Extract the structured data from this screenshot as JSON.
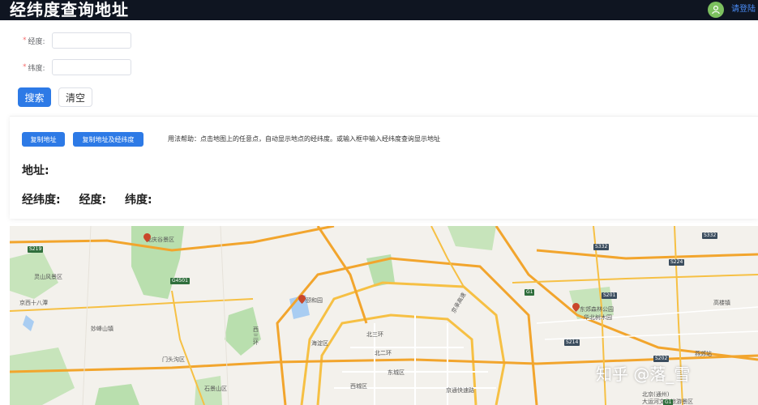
{
  "header": {
    "title": "经纬度查询地址",
    "login_link": "请登陆",
    "avatar_icon": "user-icon"
  },
  "form": {
    "longitude": {
      "required_mark": "*",
      "label": "经度:",
      "value": ""
    },
    "latitude": {
      "required_mark": "*",
      "label": "纬度:",
      "value": ""
    },
    "search_button": "搜索",
    "clear_button": "清空"
  },
  "result": {
    "copy_address_button": "复制地址",
    "copy_address_coords_button": "复制地址及经纬度",
    "help_text": "用法帮助：点击地图上的任意点，自动显示地点的经纬度。或输入框中输入经纬度查询显示地址",
    "address_label": "地址:",
    "coords_label": "经纬度:",
    "lng_label": "经度:",
    "lat_label": "纬度:"
  },
  "map": {
    "labels": {
      "longqing": "龙庆谷景区",
      "yiheyuan": "颐和园",
      "mentougou": "门头沟区",
      "xisanhuan": "西三环",
      "beisanhuan": "北三环",
      "beierhuan": "北二环",
      "haidian": "海淀区",
      "dongcheng": "东城区",
      "xicheng": "西城区",
      "shijingshan": "石景山区",
      "jingtong": "京通快速路",
      "dongjiao": "东郊森林公园",
      "huabei": "华北树木园",
      "gaolou": "高楼镇",
      "yanjiao": "燕郊站",
      "beijing_tz": "北京(通州)",
      "yunhe": "大运河文化旅游景区",
      "zhenggu": "京西十八潭",
      "miaofeng": "妙峰山镇",
      "lingshan": "灵山风景区",
      "jingcheng": "京承高速"
    },
    "shields": [
      "S219",
      "G4501",
      "S332",
      "S224",
      "S332",
      "S201",
      "G1",
      "S214",
      "S202",
      "G1"
    ]
  },
  "watermark": "知乎 @落_雪",
  "colors": {
    "header_bg": "#0f1521",
    "primary": "#2d7ae6",
    "link": "#4a8cf7",
    "avatar": "#7cc05f",
    "required": "#f56c6c"
  }
}
